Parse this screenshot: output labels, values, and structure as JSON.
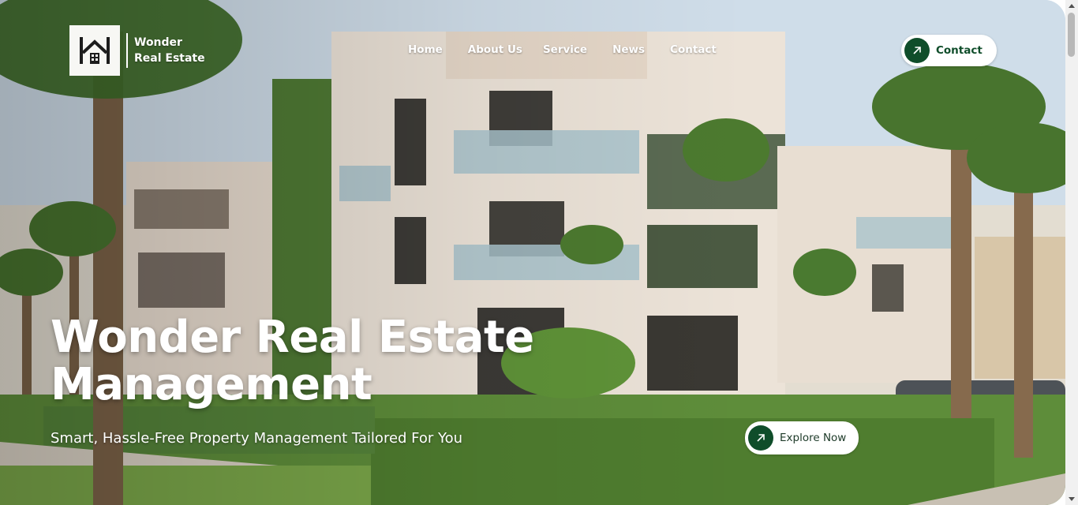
{
  "brand": {
    "line1": "Wonder",
    "line2": "Real Estate",
    "logo_icon": "house-h-icon"
  },
  "nav": {
    "items": [
      "Home",
      "About Us",
      "Service",
      "News",
      "Contact"
    ]
  },
  "header_cta": {
    "label": "Contact",
    "icon": "arrow-up-right-icon"
  },
  "hero": {
    "title_line1": "Wonder Real Estate",
    "title_line2": "Management",
    "subtitle": "Smart, Hassle-Free Property Management Tailored For You",
    "cta_label": "Explore Now",
    "cta_icon": "arrow-up-right-icon",
    "image_description": "modern villa building with balconies and palm trees"
  },
  "colors": {
    "accent": "#0f4d2a",
    "button_bg": "#ffffff",
    "text_on_image": "#ffffff"
  }
}
